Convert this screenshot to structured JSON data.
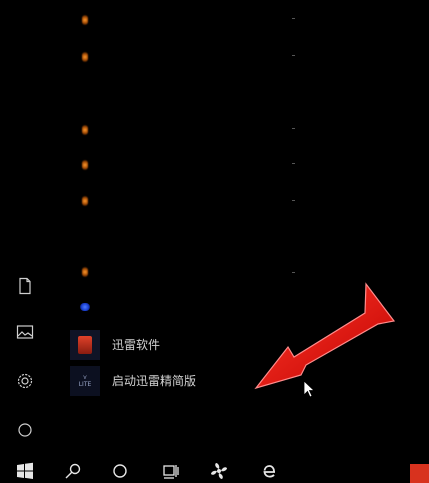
{
  "start_menu": {
    "left_rail": [
      {
        "name": "documents-icon"
      },
      {
        "name": "pictures-icon"
      },
      {
        "name": "settings-gear-icon"
      },
      {
        "name": "power-icon"
      }
    ],
    "apps": [
      {
        "label": "",
        "icon": "orange-app-icon"
      },
      {
        "label": "",
        "icon": "orange-app-icon"
      },
      {
        "label": "",
        "icon": "orange-app-icon"
      },
      {
        "label": "",
        "icon": "orange-app-icon"
      },
      {
        "label": "",
        "icon": "orange-app-icon"
      },
      {
        "label": "",
        "icon": "blank-app-icon"
      },
      {
        "label": "",
        "icon": "orange-app-icon"
      },
      {
        "label": "",
        "icon": "blue-app-icon"
      },
      {
        "label": "迅雷软件",
        "icon": "xunlei-folder-icon"
      },
      {
        "label": "启动迅雷精简版",
        "icon": "xunlei-lite-launch-icon",
        "tile_text": "LITE"
      }
    ]
  },
  "annotation": {
    "color": "#e01010"
  },
  "taskbar": {
    "items": [
      {
        "name": "start-button"
      },
      {
        "name": "search-button"
      },
      {
        "name": "cortana-button"
      },
      {
        "name": "task-view-button"
      },
      {
        "name": "fan-app-button"
      },
      {
        "name": "edge-browser-button"
      }
    ],
    "tray_accent": "#d8321e"
  }
}
